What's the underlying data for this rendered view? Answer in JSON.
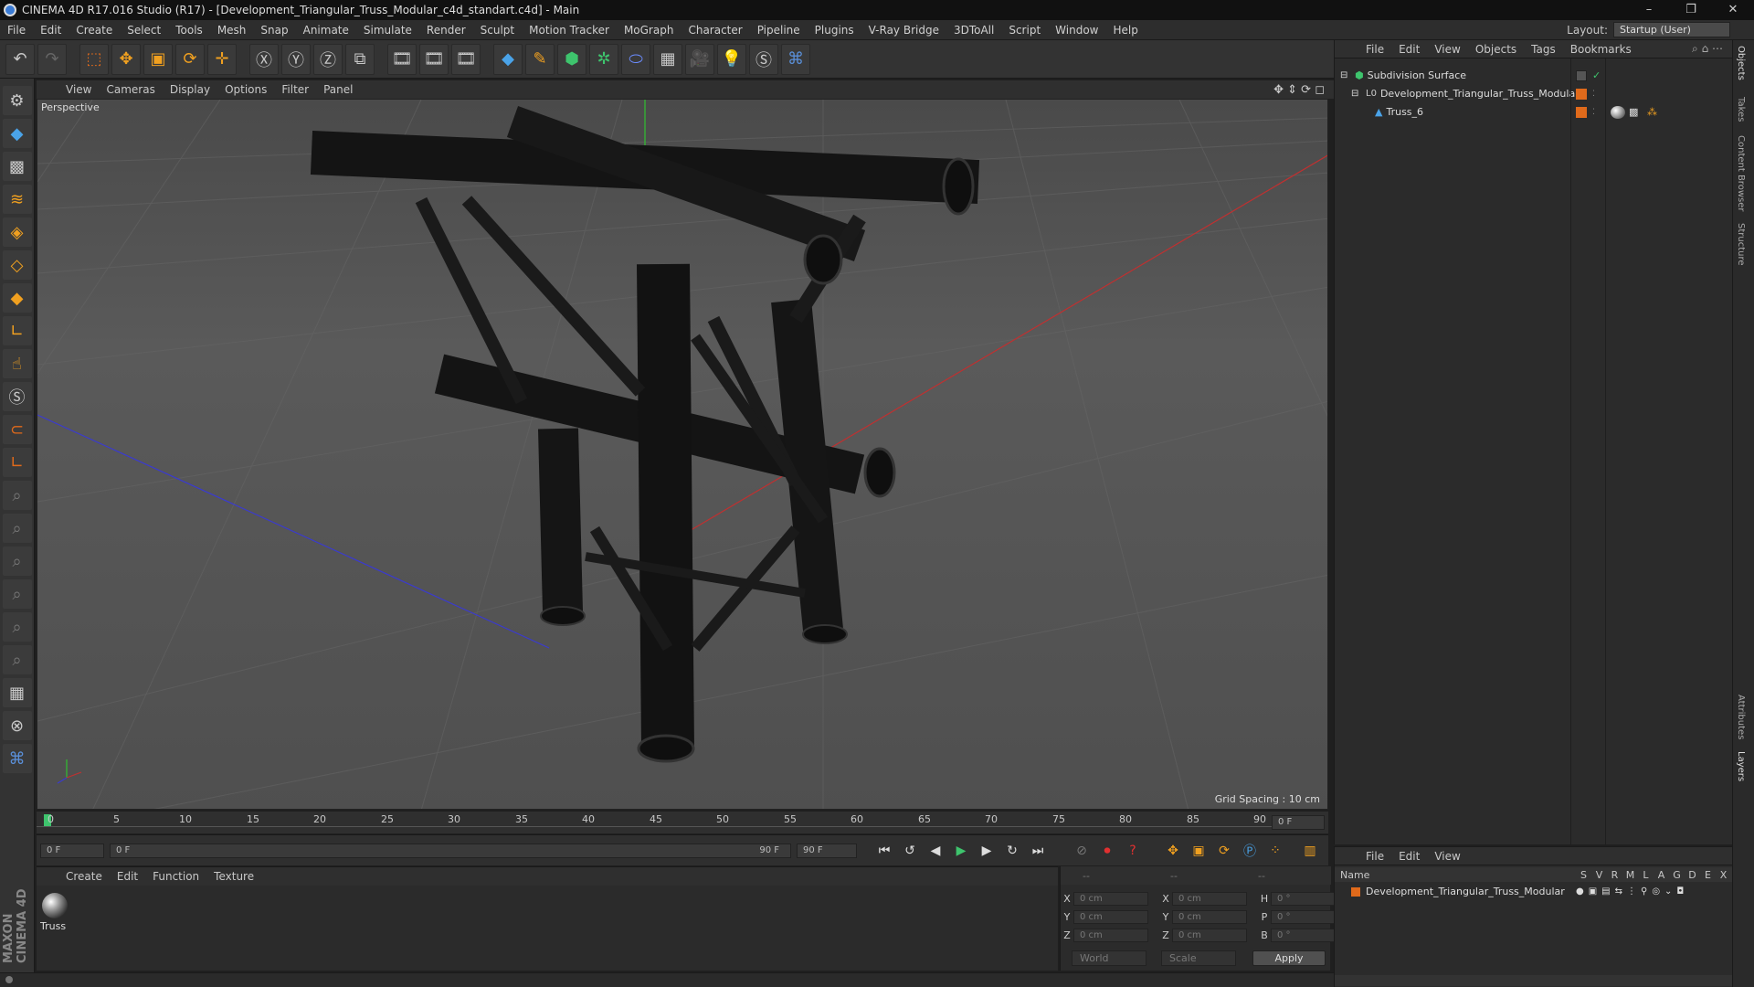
{
  "window": {
    "title": "CINEMA 4D R17.016 Studio (R17) - [Development_Triangular_Truss_Modular_c4d_standart.c4d] - Main",
    "controls": [
      "–",
      "❐",
      "✕"
    ]
  },
  "menubar": {
    "items": [
      "File",
      "Edit",
      "Create",
      "Select",
      "Tools",
      "Mesh",
      "Snap",
      "Animate",
      "Simulate",
      "Render",
      "Sculpt",
      "Motion Tracker",
      "MoGraph",
      "Character",
      "Pipeline",
      "Plugins",
      "V-Ray Bridge",
      "3DToAll",
      "Script",
      "Window",
      "Help"
    ],
    "layout_label": "Layout:",
    "layout_value": "Startup (User)"
  },
  "viewport": {
    "menu": [
      "View",
      "Cameras",
      "Display",
      "Options",
      "Filter",
      "Panel"
    ],
    "camera_label": "Perspective",
    "grid_spacing": "Grid Spacing : 10 cm"
  },
  "timeline": {
    "ticks": [
      "0",
      "5",
      "10",
      "15",
      "20",
      "25",
      "30",
      "35",
      "40",
      "45",
      "50",
      "55",
      "60",
      "65",
      "70",
      "75",
      "80",
      "85",
      "90"
    ],
    "current_frame_field": "0 F",
    "start_field": "0 F",
    "range_start": "0 F",
    "range_end": "90 F",
    "end_field": "90 F"
  },
  "material_manager": {
    "menu": [
      "Create",
      "Edit",
      "Function",
      "Texture"
    ],
    "material_name": "Truss"
  },
  "coordinates": {
    "header": [
      "--",
      "--",
      "--"
    ],
    "rows": [
      {
        "a": "X",
        "pos": "0 cm",
        "b": "X",
        "size": "0 cm",
        "c": "H",
        "rot": "0 °"
      },
      {
        "a": "Y",
        "pos": "0 cm",
        "b": "Y",
        "size": "0 cm",
        "c": "P",
        "rot": "0 °"
      },
      {
        "a": "Z",
        "pos": "0 cm",
        "b": "Z",
        "size": "0 cm",
        "c": "B",
        "rot": "0 °"
      }
    ],
    "world": "World",
    "scale": "Scale",
    "apply": "Apply"
  },
  "object_manager": {
    "menu": [
      "File",
      "Edit",
      "View",
      "Objects",
      "Tags",
      "Bookmarks"
    ],
    "objects": [
      {
        "name": "Subdivision Surface",
        "depth": 0
      },
      {
        "name": "Development_Triangular_Truss_Modular",
        "depth": 1
      },
      {
        "name": "Truss_6",
        "depth": 2
      }
    ]
  },
  "layer_manager": {
    "menu": [
      "File",
      "Edit",
      "View"
    ],
    "columns": [
      "Name",
      "S",
      "V",
      "R",
      "M",
      "L",
      "A",
      "G",
      "D",
      "E",
      "X"
    ],
    "layer_name": "Development_Triangular_Truss_Modular"
  },
  "right_tabs": [
    "Objects",
    "Takes",
    "Content Browser",
    "Structure",
    "Attributes",
    "Layers"
  ],
  "brand": "MAXON CINEMA 4D",
  "colors": {
    "accent": "#e06a1b",
    "selection_blue": "#4a6fa5"
  }
}
